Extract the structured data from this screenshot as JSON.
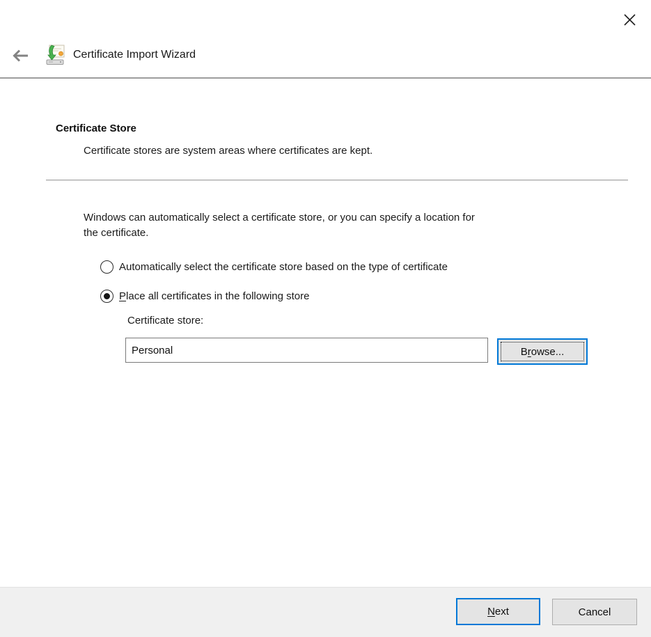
{
  "window": {
    "icons": {
      "close": "close-x",
      "back": "arrow-left",
      "wizard": "certificate-import"
    }
  },
  "header": {
    "title": "Certificate Import Wizard"
  },
  "page": {
    "heading": "Certificate Store",
    "subheading": "Certificate stores are system areas where certificates are kept.",
    "intro_lines": [
      "Windows can automatically select a certificate store, or you can specify a location for",
      "the certificate."
    ],
    "radio_auto": {
      "label": "Automatically select the certificate store based on the type of certificate",
      "selected": false
    },
    "radio_place": {
      "label_key": "P",
      "label_rest": "lace all certificates in the following store",
      "selected": true
    },
    "store_label": "Certificate store:",
    "store_value": "Personal",
    "browse_pre": "B",
    "browse_key": "r",
    "browse_rest": "owse..."
  },
  "footer": {
    "next_key": "N",
    "next_rest": "ext",
    "cancel_label": "Cancel"
  },
  "colors": {
    "accent": "#0078d7",
    "button_bg": "#e4e4e4",
    "footer_bg": "#f0f0f0",
    "divider": "#9d9d9d"
  }
}
